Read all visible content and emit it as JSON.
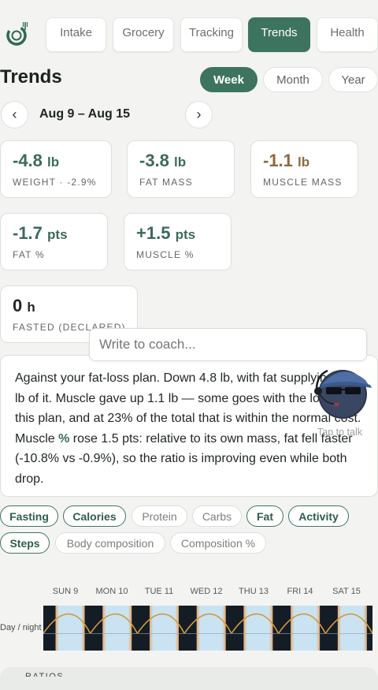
{
  "nav": {
    "tabs": [
      {
        "label": "Intake",
        "active": false
      },
      {
        "label": "Grocery",
        "active": false
      },
      {
        "label": "Tracking",
        "active": false
      },
      {
        "label": "Trends",
        "active": true
      },
      {
        "label": "Health",
        "active": false
      }
    ],
    "logo_icon": "fork-ring-logo-icon"
  },
  "page": {
    "title": "Trends",
    "periods": [
      {
        "label": "Week",
        "active": true
      },
      {
        "label": "Month",
        "active": false
      },
      {
        "label": "Year",
        "active": false
      }
    ],
    "prev_icon": "‹",
    "next_icon": "›",
    "date_range": "Aug 9 – Aug 15"
  },
  "stats": [
    {
      "value": "-4.8",
      "unit": "lb",
      "label": "WEIGHT · -2.9%",
      "color": "#3a6b58"
    },
    {
      "value": "-3.8",
      "unit": "lb",
      "label": "FAT MASS",
      "color": "#3a6b58"
    },
    {
      "value": "-1.1",
      "unit": "lb",
      "label": "MUSCLE MASS",
      "color": "#8c6a3e"
    },
    {
      "value": "-1.7",
      "unit": "pts",
      "label": "FAT %",
      "color": "#3a6b58"
    },
    {
      "value": "+1.5",
      "unit": "pts",
      "label": "MUSCLE %",
      "color": "#3a6b58"
    },
    {
      "value": "0",
      "unit": "h",
      "label": "FASTED (DECLARED)",
      "color": "#1f2622"
    }
  ],
  "coach": {
    "placeholder": "Write to coach...",
    "tap_label": "Tap to talk",
    "avatar_icon": "coach-avatar-icon"
  },
  "summary": {
    "part1": "Against your fat-loss plan. Down 4.8 lb, with fat supplying 3.8 lb of it. Muscle gave up 1.1 lb — some goes with the loss on this plan, and at 23% of the total that is within the normal cost. Muscle ",
    "highlight": "%",
    "part2": " rose 1.5 pts: relative to its own mass, fat fell faster (-10.8% vs -0.9%), so the ratio is improving even while both drop."
  },
  "chips": [
    {
      "label": "Fasting",
      "on": true
    },
    {
      "label": "Calories",
      "on": true
    },
    {
      "label": "Protein",
      "on": false
    },
    {
      "label": "Carbs",
      "on": false
    },
    {
      "label": "Fat",
      "on": true
    },
    {
      "label": "Activity",
      "on": true
    },
    {
      "label": "Steps",
      "on": true
    },
    {
      "label": "Body composition",
      "on": false
    },
    {
      "label": "Composition %",
      "on": false
    }
  ],
  "day_night": {
    "row_label": "Day / night",
    "days": [
      "SUN 9",
      "MON 10",
      "TUE 11",
      "WED 12",
      "THU 13",
      "FRI 14",
      "SAT 15"
    ],
    "colors": {
      "night": "#141c26",
      "day": "#c9e3f3",
      "sun_curve": "#d49a3a",
      "dawn": "#e8a868"
    }
  },
  "footer": {
    "partial_label": "RATIOS"
  }
}
